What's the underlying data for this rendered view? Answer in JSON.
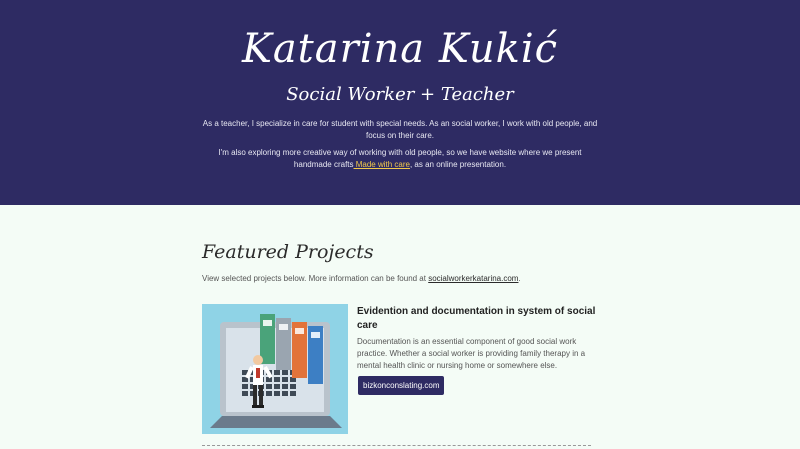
{
  "hero": {
    "name": "Katarina Kukić",
    "role": "Social Worker + Teacher",
    "intro_p1": "As a teacher, I specialize in care for student with special needs. As an social worker, I work with old people, and focus on their care.",
    "intro_p2_before": "I'm also exploring more creative way of working with old people, so we have website where we present handmade crafts",
    "intro_p2_link": " Made with care",
    "intro_p2_after": ", as an online presentation."
  },
  "featured": {
    "title": "Featured Projects",
    "desc_before": "View selected projects below. More information can be found at ",
    "desc_link": "socialworkerkatarina.com",
    "desc_after": "."
  },
  "project": {
    "title": "Evidention and documentation in system of social care",
    "body": "Documentation is an essential component of good social work practice. Whether a social worker is providing family therapy in a mental health clinic or nursing home or somewhere else.",
    "button": "bizkonconslating.com"
  },
  "colors": {
    "hero_bg": "#2e2b63",
    "page_bg": "#f4fcf6",
    "link_accent": "#f2c94c",
    "button_bg": "#2e2b63"
  }
}
